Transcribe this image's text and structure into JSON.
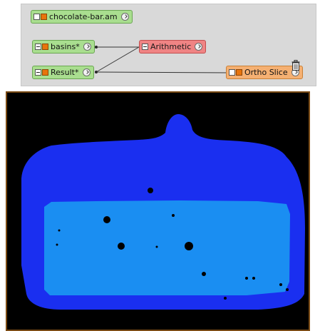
{
  "pool": {
    "nodes": {
      "chocolate": {
        "label": "chocolate-bar.am"
      },
      "basins": {
        "label": "basins*"
      },
      "result": {
        "label": "Result*"
      },
      "arithmetic": {
        "label": "Arithmetic"
      },
      "ortho": {
        "label": "Ortho Slice"
      }
    }
  },
  "colors": {
    "data_node": "#a9de8f",
    "compute_node": "#f08484",
    "display_node": "#f5b072",
    "viewer_background": "#000000",
    "outer_region": "#1a2ff0",
    "inner_region": "#1a8ef2"
  },
  "icons": {
    "port": "chevron-right-circle-icon",
    "trash": "trash-icon"
  }
}
